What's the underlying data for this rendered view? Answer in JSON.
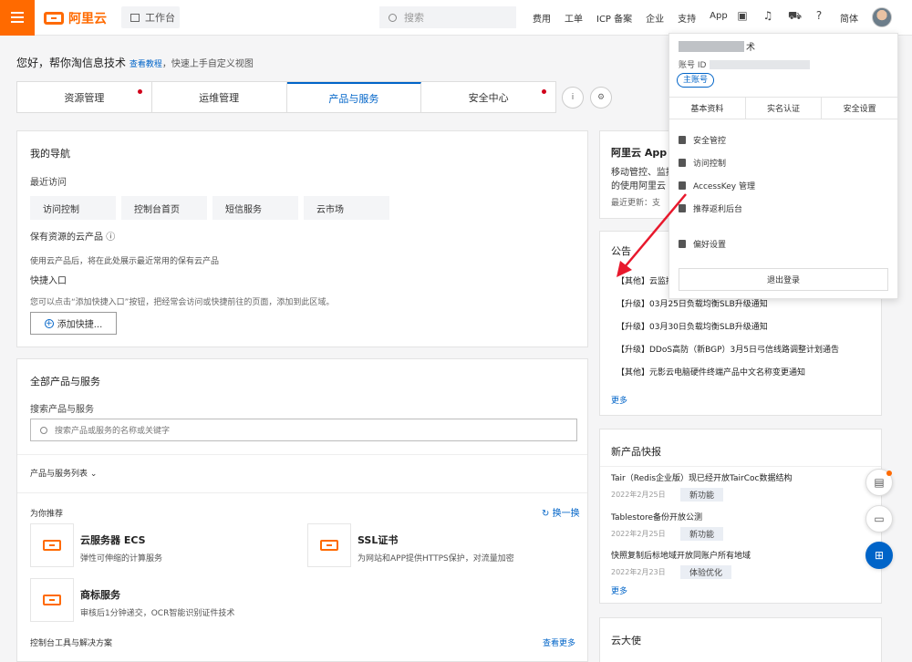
{
  "topbar": {
    "logo_text": "阿里云",
    "workbench_label": "工作台",
    "search_placeholder": "搜索",
    "nav": [
      "费用",
      "工单",
      "ICP 备案",
      "企业",
      "支持",
      "App"
    ],
    "icons": [
      "screen-icon",
      "bell-icon",
      "cart-icon",
      "help-icon"
    ],
    "language": "简体"
  },
  "greeting": {
    "text": "您好，帮你淘信息技术",
    "link": "查看教程",
    "suffix": "，快速上手自定义视图"
  },
  "tabs": [
    "资源管理",
    "运维管理",
    "产品与服务",
    "安全中心"
  ],
  "my_nav": {
    "title": "我的导航",
    "recent_label": "最近访问",
    "recent": [
      "访问控制",
      "控制台首页",
      "短信服务",
      "云市场"
    ],
    "owned_label": "保有资源的云产品",
    "owned_desc": "使用云产品后，将在此处展示最近常用的保有云产品",
    "quick_label": "快捷入口",
    "quick_desc": "您可以点击“添加快捷入口”按钮，把经常会访问或快捷前往的页面，添加到此区域。",
    "add_button": "添加快捷..."
  },
  "all_products": {
    "title": "全部产品与服务",
    "search_label": "搜索产品与服务",
    "search_placeholder": "搜索产品或服务的名称或关键字",
    "list_toggle": "产品与服务列表",
    "recommend": "为你推荐",
    "refresh": "换一换",
    "products": [
      {
        "name": "云服务器 ECS",
        "desc": "弹性可伸缩的计算服务"
      },
      {
        "name": "SSL证书",
        "desc": "为网站和APP提供HTTPS保护，对流量加密"
      },
      {
        "name": "商标服务",
        "desc": "审核后1分钟递交，OCR智能识别证件技术"
      }
    ],
    "tools_label": "控制台工具与解决方案",
    "see_more": "查看更多"
  },
  "app_card": {
    "title": "阿里云 App",
    "line1": "移动管控、监控",
    "line2": "的使用阿里云",
    "line3": "最近更新：支"
  },
  "notice": {
    "title": "公告",
    "items": [
      "【其他】云监控",
      "【升级】03月25日负载均衡SLB升级通知",
      "【升级】03月30日负载均衡SLB升级通知",
      "【升级】DDoS高防（新BGP）3月5日弓信线路调整计划通告",
      "【其他】元影云电脑硬件终端产品中文名称变更通知"
    ],
    "more": "更多"
  },
  "new_products": {
    "title": "新产品快报",
    "items": [
      {
        "name": "Tair（Redis企业版）现已经开放TairCoc数据结构",
        "date": "2022年2月25日",
        "badge": "新功能"
      },
      {
        "name": "Tablestore备份开放公测",
        "date": "2022年2月25日",
        "badge": "新功能"
      },
      {
        "name": "快照复制后标地域开放同账户所有地域",
        "date": "2022年2月23日",
        "badge": "体验优化"
      }
    ],
    "more": "更多"
  },
  "ambassador": {
    "title": "云大使"
  },
  "dropdown": {
    "name_suffix": "术",
    "account_label": "账号 ID",
    "main_account": "主账号",
    "tabs": [
      "基本资料",
      "实名认证",
      "安全设置"
    ],
    "menu": [
      "安全管控",
      "访问控制",
      "AccessKey 管理",
      "推荐返利后台"
    ],
    "preferences": "偏好设置",
    "logout": "退出登录"
  },
  "colors": {
    "brand": "#ff6a00",
    "link": "#0064c8",
    "alert": "#d1001a",
    "annotation_arrow": "#e8182c"
  }
}
